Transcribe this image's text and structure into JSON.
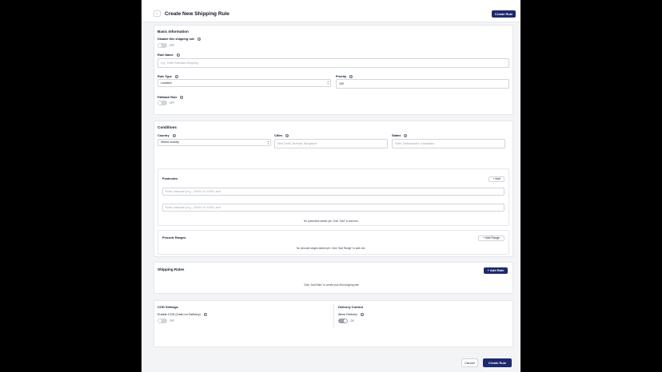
{
  "header": {
    "back_icon": "arrow-left-icon",
    "title": "Create New Shipping Rule",
    "create_label": "Create Rule"
  },
  "basic": {
    "title": "Basic Information",
    "disable_label": "Disable this shipping rule",
    "disable_state": "OFF",
    "rule_name_label": "Rule Name",
    "rule_name_placeholder": "e.g., Delhi Standard Shipping",
    "rule_type_label": "Rule Type",
    "rule_type_value": "Location",
    "priority_label": "Priority",
    "priority_value": "100",
    "fallback_label": "Fallback Rule",
    "fallback_state": "OFF"
  },
  "conditions": {
    "title": "Conditions",
    "country_label": "Country",
    "country_value": "Select country",
    "cities_label": "Cities",
    "cities_placeholder": "New Delhi, Mumbai, Bangalore",
    "states_label": "States",
    "states_placeholder": "Delhi, Maharashtra, Karnataka",
    "postcodes_label": "Postcodes",
    "add_label": "Add",
    "postcode_placeholder_1": "Enter postcode (e.g., 110001 or 1100*) and",
    "postcode_placeholder_2": "Enter postcode (e.g., 110001 or 1100*) and",
    "postcodes_empty": "No postcodes added yet. Click \"Add\" to add one.",
    "pincode_ranges_label": "Pincode Ranges",
    "add_range_label": "Add Range",
    "ranges_empty": "No pincode ranges added yet. Click \"Add Range\" to add one."
  },
  "rates": {
    "title": "Shipping Rates",
    "add_rate_label": "Add Rate",
    "empty": "Click \"Add Rate\" to create your first shipping rate"
  },
  "cod": {
    "title": "COD Settings",
    "enable_label": "Enable COD (Cash on Delivery)",
    "enable_state": "OFF"
  },
  "delivery": {
    "title": "Delivery Control",
    "allow_label": "Allow Delivery",
    "allow_state": "ON"
  },
  "footer": {
    "cancel_label": "Cancel",
    "create_label": "Create Rule"
  }
}
